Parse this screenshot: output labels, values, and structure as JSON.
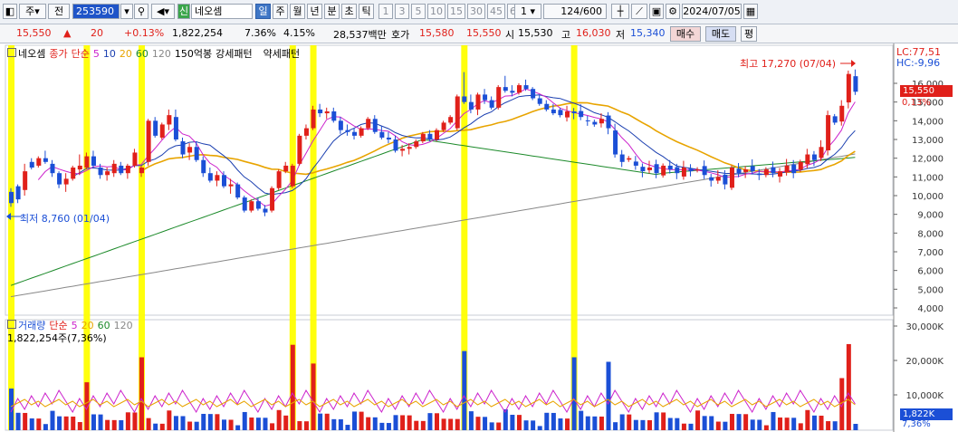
{
  "toolbar": {
    "code": "253590",
    "name": "네오셈",
    "type_label": "주",
    "all_label": "전",
    "credit_label": "신",
    "periods": [
      "일",
      "주",
      "월",
      "년",
      "분",
      "초",
      "틱"
    ],
    "minutes": [
      "1",
      "3",
      "5",
      "10",
      "15",
      "30",
      "45",
      "60"
    ],
    "interval_value": "1",
    "count": "124/600",
    "date": "2024/07/05"
  },
  "quote": {
    "price": "15,550",
    "change": "20",
    "change_pct": "+0.13%",
    "volume": "1,822,254",
    "turnover_pct": "7.36%",
    "ratio": "4.15%",
    "amount": "28,537백만",
    "ask_label": "호가",
    "ask": "15,580",
    "bid": "15,550",
    "open_label": "시",
    "open": "15,530",
    "high_label": "고",
    "high": "16,030",
    "low_label": "저",
    "low": "15,340",
    "buy_label": "매수",
    "sell_label": "매도",
    "eval_label": "평"
  },
  "price_legend": {
    "stock": "네오셈",
    "close": "종가",
    "simple": "단순",
    "ma": [
      "5",
      "10",
      "20",
      "60",
      "120"
    ],
    "ma_colors": [
      "#cc22cc",
      "#1b3fb0",
      "#e8a400",
      "#1c8a2a",
      "#888888"
    ],
    "pattern1": "150억봉",
    "pattern2": "강세패턴",
    "pattern3": "약세패턴"
  },
  "vol_legend": {
    "label": "거래량",
    "simple": "단순",
    "ma": [
      "5",
      "20",
      "60",
      "120"
    ],
    "current": "1,822,254주(7,36%)"
  },
  "annotations": {
    "high": "최고 17,270 (07/04)",
    "low": "최저 8,760 (01/04)",
    "lc": "LC:77,51",
    "hc": "HC:-9,96",
    "price_badge": "15,550",
    "pct_label": "0,13%",
    "vol_badge": "1,822K",
    "vol_pct": "7,36%"
  },
  "price_axis": [
    "16,000",
    "15,000",
    "14,000",
    "13,000",
    "12,000",
    "11,000",
    "10,000",
    "9,000",
    "8,000",
    "7,000",
    "6,000",
    "5,000",
    "4,000"
  ],
  "volume_axis": [
    "30,000K",
    "20,000K",
    "10,000K"
  ],
  "colors": {
    "up": "#e0201a",
    "down": "#1b4fd6",
    "highlight": "#ffff00"
  },
  "chart_data": {
    "type": "candlestick",
    "n": 124,
    "highlight_index": [
      0,
      11,
      19,
      40,
      43,
      65,
      127
    ],
    "ohlc": [
      [
        10200,
        10400,
        9400,
        9600
      ],
      [
        10500,
        10600,
        9600,
        9800
      ],
      [
        10300,
        11700,
        10000,
        11300
      ],
      [
        11800,
        12000,
        11400,
        11500
      ],
      [
        11600,
        12100,
        11500,
        12000
      ],
      [
        12000,
        12400,
        11700,
        11800
      ],
      [
        11700,
        11900,
        11000,
        11200
      ],
      [
        11200,
        11300,
        10400,
        10600
      ],
      [
        10600,
        11200,
        10200,
        10900
      ],
      [
        10900,
        11600,
        10800,
        11500
      ],
      [
        11400,
        12200,
        11100,
        11600
      ],
      [
        11500,
        12300,
        11400,
        12100
      ],
      [
        12100,
        12400,
        11500,
        11600
      ],
      [
        11500,
        11700,
        10900,
        11100
      ],
      [
        11100,
        11500,
        10800,
        11300
      ],
      [
        11200,
        11900,
        11000,
        11700
      ],
      [
        11600,
        11800,
        11100,
        11200
      ],
      [
        11200,
        11700,
        10900,
        11600
      ],
      [
        11600,
        12500,
        11500,
        12300
      ],
      [
        11200,
        11600,
        11000,
        11500
      ],
      [
        11800,
        14100,
        11600,
        14000
      ],
      [
        14000,
        14200,
        13100,
        13200
      ],
      [
        13100,
        13900,
        13000,
        13800
      ],
      [
        13800,
        14600,
        13500,
        14300
      ],
      [
        14200,
        14600,
        12900,
        13000
      ],
      [
        12900,
        13100,
        12000,
        12200
      ],
      [
        12300,
        12800,
        11900,
        12600
      ],
      [
        12600,
        12900,
        11800,
        11900
      ],
      [
        11900,
        12100,
        11000,
        11200
      ],
      [
        11200,
        11500,
        10700,
        10800
      ],
      [
        10800,
        11300,
        10500,
        11100
      ],
      [
        11100,
        11300,
        10400,
        10500
      ],
      [
        10500,
        10900,
        10100,
        10600
      ],
      [
        10600,
        10700,
        9800,
        9900
      ],
      [
        9900,
        10000,
        9100,
        9200
      ],
      [
        9200,
        9800,
        9100,
        9700
      ],
      [
        9700,
        9900,
        9200,
        9300
      ],
      [
        9300,
        9500,
        8900,
        9100
      ],
      [
        9200,
        10500,
        9100,
        10400
      ],
      [
        10400,
        11400,
        10300,
        11300
      ],
      [
        11300,
        11800,
        11200,
        11600
      ],
      [
        10500,
        11700,
        10400,
        11600
      ],
      [
        11700,
        13300,
        11600,
        13200
      ],
      [
        13200,
        13800,
        13000,
        13600
      ],
      [
        13600,
        14800,
        13500,
        14600
      ],
      [
        14600,
        14900,
        14200,
        14400
      ],
      [
        14400,
        14700,
        14100,
        14500
      ],
      [
        14500,
        14700,
        13900,
        14000
      ],
      [
        14000,
        14200,
        13300,
        13500
      ],
      [
        13500,
        13800,
        13200,
        13400
      ],
      [
        13400,
        13600,
        13000,
        13200
      ],
      [
        13200,
        13700,
        13100,
        13600
      ],
      [
        13600,
        14200,
        13500,
        14100
      ],
      [
        14100,
        14300,
        13300,
        13400
      ],
      [
        13400,
        13700,
        13000,
        13100
      ],
      [
        13100,
        13400,
        12800,
        13000
      ],
      [
        13000,
        13200,
        12300,
        12400
      ],
      [
        12400,
        12700,
        12100,
        12500
      ],
      [
        12500,
        12800,
        12200,
        12600
      ],
      [
        12600,
        13000,
        12500,
        12900
      ],
      [
        12900,
        13400,
        12800,
        13300
      ],
      [
        13300,
        13500,
        12900,
        13000
      ],
      [
        13000,
        13600,
        12900,
        13500
      ],
      [
        13500,
        14000,
        13400,
        13900
      ],
      [
        13900,
        14300,
        13800,
        14200
      ],
      [
        13600,
        15400,
        13500,
        15300
      ],
      [
        15300,
        16600,
        14900,
        15000
      ],
      [
        15000,
        15400,
        14400,
        14600
      ],
      [
        14600,
        15500,
        14300,
        15400
      ],
      [
        15400,
        15700,
        14900,
        15100
      ],
      [
        15100,
        15300,
        14600,
        14700
      ],
      [
        14700,
        15900,
        14600,
        15800
      ],
      [
        15800,
        16400,
        15500,
        15600
      ],
      [
        15600,
        15900,
        15300,
        15500
      ],
      [
        15500,
        16000,
        15400,
        15900
      ],
      [
        15900,
        16200,
        15600,
        15700
      ],
      [
        15700,
        15800,
        15100,
        15200
      ],
      [
        15200,
        15400,
        14800,
        14900
      ],
      [
        14900,
        15100,
        14500,
        14600
      ],
      [
        14600,
        14900,
        14300,
        14400
      ]
    ]
  }
}
